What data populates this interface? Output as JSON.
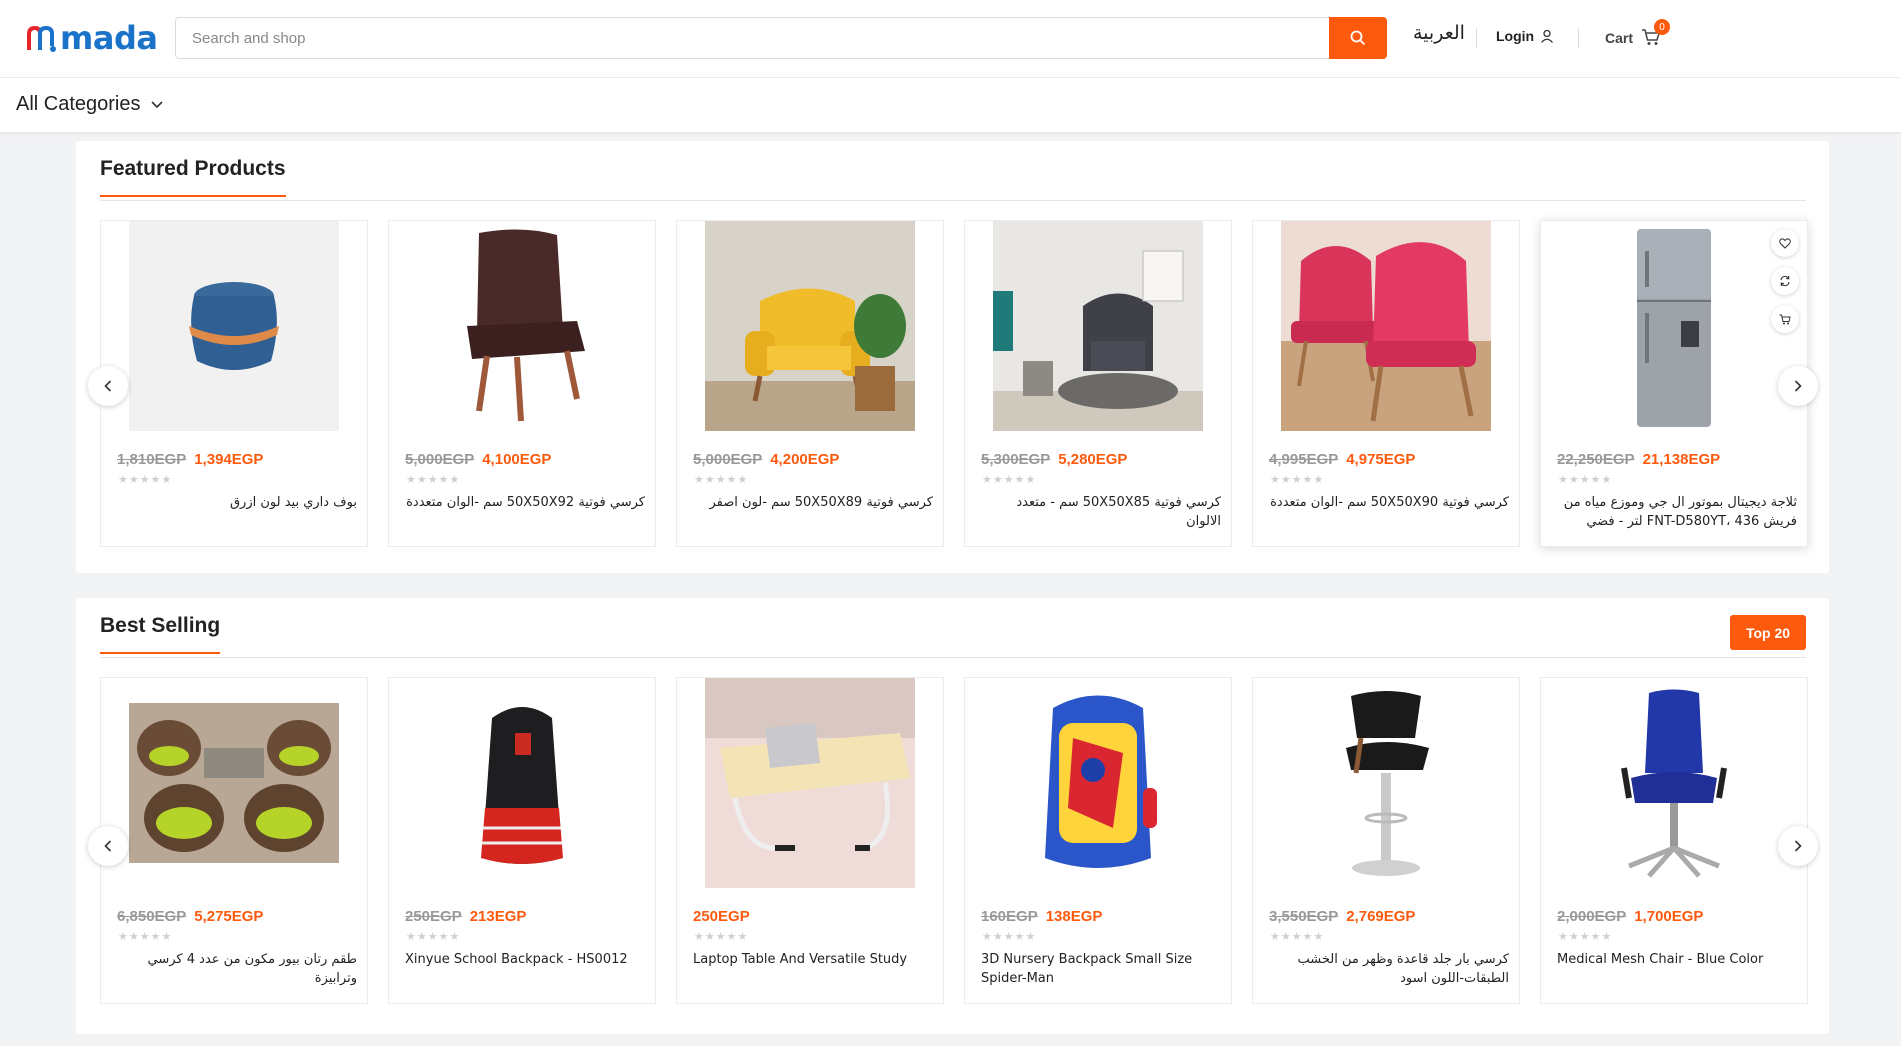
{
  "header": {
    "logo_text": "mada",
    "search_placeholder": "Search and shop",
    "language": "العربية",
    "login_label": "Login",
    "cart_label": "Cart",
    "cart_count": "0",
    "all_categories": "All Categories"
  },
  "colors": {
    "accent": "#fd5a0e",
    "brand_blue": "#1a73c9",
    "brand_red": "#e8242b"
  },
  "featured": {
    "title": "Featured Products",
    "products": [
      {
        "old_price": "1,810EGP",
        "price": "1,394EGP",
        "name": "بوف داري بيد لون ازرق",
        "image": "blue-pouf"
      },
      {
        "old_price": "5,000EGP",
        "price": "4,100EGP",
        "name": "كرسي فوتية 50X50X92 سم -الوان متعددة",
        "image": "brown-chair"
      },
      {
        "old_price": "5,000EGP",
        "price": "4,200EGP",
        "name": "كرسي فوتية 50X50X89 سم -لون اصفر",
        "image": "yellow-armchair"
      },
      {
        "old_price": "5,300EGP",
        "price": "5,280EGP",
        "name": "كرسي فوتية 50X50X85 سم - متعدد الالوان",
        "image": "gray-tub-chair"
      },
      {
        "old_price": "4,995EGP",
        "price": "4,975EGP",
        "name": "كرسي فوتية 50X50X90 سم -الوان متعددة",
        "image": "pink-chairs"
      },
      {
        "old_price": "22,250EGP",
        "price": "21,138EGP",
        "name": "ثلاجة ديجيتال بموتور ال جي وموزع مياه من فريش FNT-D580YT، 436 لتر - فضي",
        "image": "silver-fridge"
      }
    ]
  },
  "best_selling": {
    "title": "Best Selling",
    "top_label": "Top 20",
    "products": [
      {
        "old_price": "6,850EGP",
        "price": "5,275EGP",
        "name": "طقم رتان بيور مكون من عدد 4 كرسي وترابيزة",
        "image": "rattan-set",
        "rtl": true
      },
      {
        "old_price": "250EGP",
        "price": "213EGP",
        "name": "Xinyue School Backpack - HS0012",
        "image": "black-red-backpack",
        "rtl": false
      },
      {
        "old_price": "",
        "price": "250EGP",
        "name": "Laptop Table And Versatile Study",
        "image": "laptop-table",
        "rtl": false
      },
      {
        "old_price": "160EGP",
        "price": "138EGP",
        "name": "3D Nursery Backpack Small Size Spider-Man",
        "image": "spiderman-backpack",
        "rtl": false
      },
      {
        "old_price": "3,550EGP",
        "price": "2,769EGP",
        "name": "كرسي بار جلد قاعدة وظهر من الخشب الطبقات-اللون اسود",
        "image": "bar-stool",
        "rtl": true
      },
      {
        "old_price": "2,000EGP",
        "price": "1,700EGP",
        "name": "Medical Mesh Chair - Blue Color",
        "image": "blue-office-chair",
        "rtl": false
      }
    ]
  }
}
